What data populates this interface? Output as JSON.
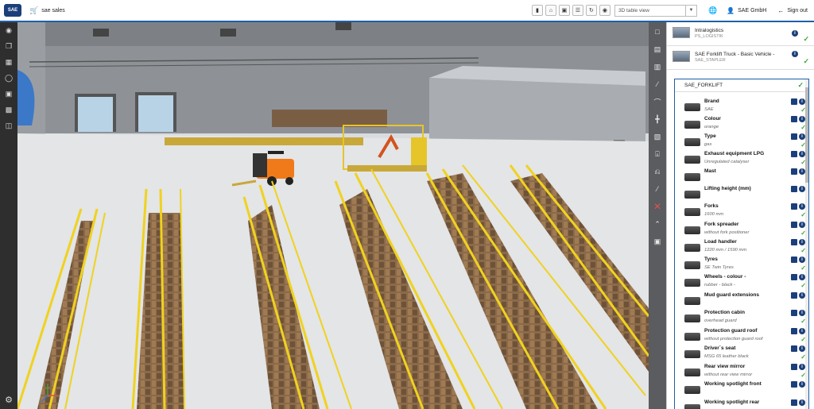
{
  "header": {
    "logo": "SAE",
    "app_title": "sae sales",
    "view_select": "3D table view",
    "company": "SAE GmbH",
    "signout": "Sign out"
  },
  "panel": {
    "top_items": [
      {
        "title": "Intralogistics",
        "sub": "PS_LOGISTIK"
      },
      {
        "title": "SAE Forklift Truck - Basic Vehicle -",
        "sub": "SAE_STAPLER"
      }
    ],
    "section_title": "SAE_FORKLIFT",
    "rows": [
      {
        "label": "Brand",
        "value": "SAE"
      },
      {
        "label": "Colour",
        "value": "orange"
      },
      {
        "label": "Type",
        "value": "gas"
      },
      {
        "label": "Exhaust equipment LPG",
        "value": "Unregulated catalyser"
      },
      {
        "label": "Mast",
        "value": ""
      },
      {
        "label": "Lifting height (mm)",
        "value": ""
      },
      {
        "label": "Forks",
        "value": "1600 mm"
      },
      {
        "label": "Fork spreader",
        "value": "without fork positioner"
      },
      {
        "label": "Load handler",
        "value": "1220 mm / 1590 mm"
      },
      {
        "label": "Tyres",
        "value": "SE Twin Tyres"
      },
      {
        "label": "Wheels - colour -",
        "value": "rubber - black -"
      },
      {
        "label": "Mud guard extensions",
        "value": ""
      },
      {
        "label": "Protection cabin",
        "value": "overhead guard"
      },
      {
        "label": "Protection guard roof",
        "value": "without protection guard roof"
      },
      {
        "label": "Driver`s seat",
        "value": "MSG 65 leather black"
      },
      {
        "label": "Rear view mirror",
        "value": "without rear view mirror"
      },
      {
        "label": "Working spotlight front",
        "value": ""
      },
      {
        "label": "Working spotlight rear",
        "value": ""
      }
    ]
  },
  "icons": {
    "left": [
      "eye-icon",
      "copy-icon",
      "layers-icon",
      "tag-icon",
      "camera-icon",
      "save-icon",
      "forklift-icon"
    ],
    "right": [
      "panel-icon",
      "rack-icon",
      "shelf-icon",
      "conveyor-icon",
      "curve-icon",
      "frame-icon",
      "stack-icon",
      "bracket-icon",
      "lamp-icon",
      "wrench-icon",
      "delete-icon",
      "roof-icon",
      "box-icon"
    ]
  },
  "colors": {
    "accent": "#1f5fa8",
    "check": "#3aa43a",
    "rack_yellow": "#f0d21e",
    "forklift_orange": "#f07a1a"
  }
}
